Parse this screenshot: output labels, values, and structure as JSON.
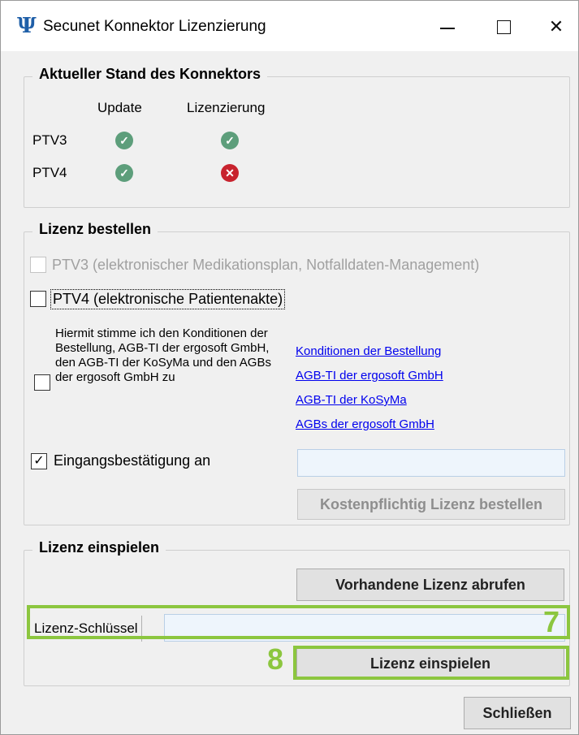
{
  "window": {
    "title": "Secunet Konnektor Lizenzierung",
    "app_icon": "psi-icon",
    "controls": [
      "minimize-icon",
      "maximize-icon",
      "close-icon"
    ],
    "close_glyph": "✕"
  },
  "status_group": {
    "legend": "Aktueller Stand des Konnektors",
    "col_update": "Update",
    "col_license": "Lizenzierung",
    "rows": [
      {
        "label": "PTV3",
        "update": "ok",
        "license": "ok"
      },
      {
        "label": "PTV4",
        "update": "ok",
        "license": "error"
      }
    ],
    "ok_glyph": "✓",
    "error_glyph": "✕",
    "ok_color": "#5d9e7b",
    "error_color": "#c8232e"
  },
  "order_group": {
    "legend": "Lizenz bestellen",
    "ptv3_label": "PTV3 (elektronischer Medikationsplan, Notfalldaten-Management)",
    "ptv4_label": "PTV4 (elektronische Patientenakte)",
    "agree_text": "Hiermit stimme ich den Konditionen der Bestellung, AGB-TI der ergosoft GmbH, den AGB-TI der KoSyMa und den AGBs der ergosoft GmbH zu",
    "links": [
      "Konditionen der Bestellung",
      "AGB-TI der ergosoft GmbH",
      "AGB-TI der KoSyMa",
      "AGBs der ergosoft GmbH"
    ],
    "receipt_label": "Eingangsbestätigung an",
    "receipt_checked": true,
    "check_glyph": "✓",
    "email_value": "",
    "order_button": "Kostenpflichtig Lizenz bestellen"
  },
  "install_group": {
    "legend": "Lizenz einspielen",
    "fetch_button": "Vorhandene Lizenz abrufen",
    "key_label": "Lizenz-Schlüssel",
    "key_value": "",
    "install_button": "Lizenz einspielen",
    "marker_key": "7",
    "marker_install": "8",
    "highlight_color": "#8cc63f"
  },
  "close_button": "Schließen"
}
